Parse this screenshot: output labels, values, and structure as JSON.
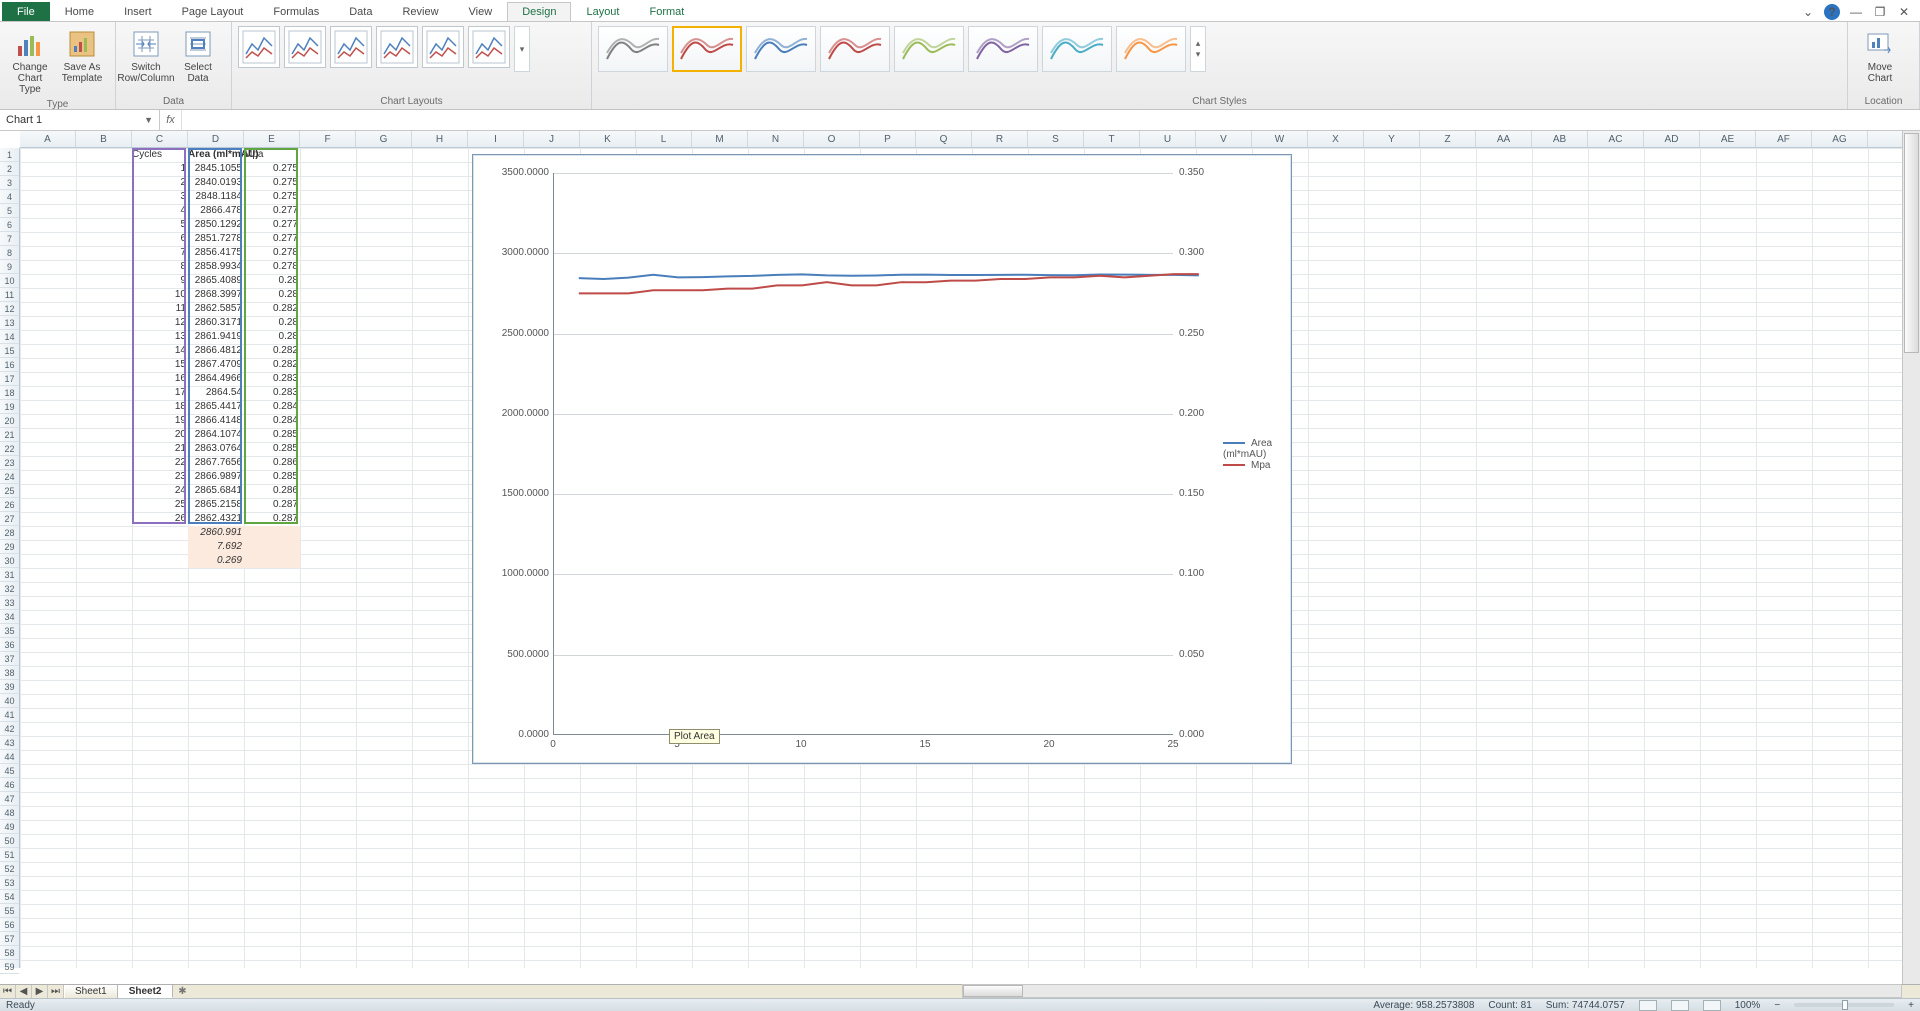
{
  "tabs": {
    "file": "File",
    "list": [
      "Home",
      "Insert",
      "Page Layout",
      "Formulas",
      "Data",
      "Review",
      "View"
    ],
    "contextual": [
      "Design",
      "Layout",
      "Format"
    ],
    "active": "Design"
  },
  "ribbon": {
    "type_group": "Type",
    "data_group": "Data",
    "layouts_group": "Chart Layouts",
    "styles_group": "Chart Styles",
    "location_group": "Location",
    "change_type": "Change\nChart Type",
    "save_template": "Save As\nTemplate",
    "switch_rc": "Switch\nRow/Column",
    "select_data": "Select\nData",
    "move_chart": "Move\nChart"
  },
  "namebox": "Chart 1",
  "columns": [
    "A",
    "B",
    "C",
    "D",
    "E",
    "F",
    "G",
    "H",
    "I",
    "J",
    "K",
    "L",
    "M",
    "N",
    "O",
    "P",
    "Q",
    "R",
    "S",
    "T",
    "U",
    "V",
    "W",
    "X",
    "Y",
    "Z",
    "AA",
    "AB",
    "AC",
    "AD",
    "AE",
    "AF",
    "AG"
  ],
  "headers": {
    "c": "Cycles",
    "d": "Area (ml*mAU)",
    "e": "Mpa"
  },
  "rows": [
    {
      "c": 1,
      "d": "2845.1055",
      "e": "0.275"
    },
    {
      "c": 2,
      "d": "2840.0193",
      "e": "0.275"
    },
    {
      "c": 3,
      "d": "2848.1184",
      "e": "0.275"
    },
    {
      "c": 4,
      "d": "2866.478",
      "e": "0.277"
    },
    {
      "c": 5,
      "d": "2850.1292",
      "e": "0.277"
    },
    {
      "c": 6,
      "d": "2851.7278",
      "e": "0.277"
    },
    {
      "c": 7,
      "d": "2856.4175",
      "e": "0.278"
    },
    {
      "c": 8,
      "d": "2858.9934",
      "e": "0.278"
    },
    {
      "c": 9,
      "d": "2865.4089",
      "e": "0.28"
    },
    {
      "c": 10,
      "d": "2868.3997",
      "e": "0.28"
    },
    {
      "c": 11,
      "d": "2862.5857",
      "e": "0.282"
    },
    {
      "c": 12,
      "d": "2860.3171",
      "e": "0.28"
    },
    {
      "c": 13,
      "d": "2861.9419",
      "e": "0.28"
    },
    {
      "c": 14,
      "d": "2866.4812",
      "e": "0.282"
    },
    {
      "c": 15,
      "d": "2867.4709",
      "e": "0.282"
    },
    {
      "c": 16,
      "d": "2864.4966",
      "e": "0.283"
    },
    {
      "c": 17,
      "d": "2864.54",
      "e": "0.283"
    },
    {
      "c": 18,
      "d": "2865.4417",
      "e": "0.284"
    },
    {
      "c": 19,
      "d": "2866.4148",
      "e": "0.284"
    },
    {
      "c": 20,
      "d": "2864.1074",
      "e": "0.285"
    },
    {
      "c": 21,
      "d": "2863.0764",
      "e": "0.285"
    },
    {
      "c": 22,
      "d": "2867.7656",
      "e": "0.286"
    },
    {
      "c": 23,
      "d": "2866.9897",
      "e": "0.285"
    },
    {
      "c": 24,
      "d": "2865.6841",
      "e": "0.286"
    },
    {
      "c": 25,
      "d": "2865.2158",
      "e": "0.287"
    },
    {
      "c": 26,
      "d": "2862.4321",
      "e": "0.287"
    }
  ],
  "summary": [
    "2860.991",
    "7.692",
    "0.269"
  ],
  "chart_data": {
    "type": "line",
    "x": [
      1,
      2,
      3,
      4,
      5,
      6,
      7,
      8,
      9,
      10,
      11,
      12,
      13,
      14,
      15,
      16,
      17,
      18,
      19,
      20,
      21,
      22,
      23,
      24,
      25,
      26
    ],
    "series": [
      {
        "name": "Area (ml*mAU)",
        "axis": "primary",
        "color": "#4a7ebb",
        "values": [
          2845.1055,
          2840.0193,
          2848.1184,
          2866.478,
          2850.1292,
          2851.7278,
          2856.4175,
          2858.9934,
          2865.4089,
          2868.3997,
          2862.5857,
          2860.3171,
          2861.9419,
          2866.4812,
          2867.4709,
          2864.4966,
          2864.54,
          2865.4417,
          2866.4148,
          2864.1074,
          2863.0764,
          2867.7656,
          2866.9897,
          2865.6841,
          2865.2158,
          2862.4321
        ]
      },
      {
        "name": "Mpa",
        "axis": "secondary",
        "color": "#be4b48",
        "values": [
          0.275,
          0.275,
          0.275,
          0.277,
          0.277,
          0.277,
          0.278,
          0.278,
          0.28,
          0.28,
          0.282,
          0.28,
          0.28,
          0.282,
          0.282,
          0.283,
          0.283,
          0.284,
          0.284,
          0.285,
          0.285,
          0.286,
          0.285,
          0.286,
          0.287,
          0.287
        ]
      }
    ],
    "y1": {
      "min": 0,
      "max": 3500,
      "ticks": [
        "0.0000",
        "500.0000",
        "1000.0000",
        "1500.0000",
        "2000.0000",
        "2500.0000",
        "3000.0000",
        "3500.0000"
      ]
    },
    "y2": {
      "min": 0,
      "max": 0.35,
      "ticks": [
        "0.000",
        "0.050",
        "0.100",
        "0.150",
        "0.200",
        "0.250",
        "0.300",
        "0.350"
      ]
    },
    "x_ticks": [
      "0",
      "5",
      "10",
      "15",
      "20",
      "25"
    ],
    "tooltip": "Plot Area"
  },
  "sheets": {
    "list": [
      "Sheet1",
      "Sheet2"
    ],
    "active": "Sheet2"
  },
  "status": {
    "mode": "Ready",
    "average_lbl": "Average:",
    "average": "958.2573808",
    "count_lbl": "Count:",
    "count": "81",
    "sum_lbl": "Sum:",
    "sum": "74744.0757",
    "zoom": "100%"
  },
  "style_colors": [
    "#808080",
    "#be4b48",
    "#4a7ebb",
    "#be4b48",
    "#9bbb59",
    "#8064a2",
    "#4bacc6",
    "#f79646"
  ]
}
